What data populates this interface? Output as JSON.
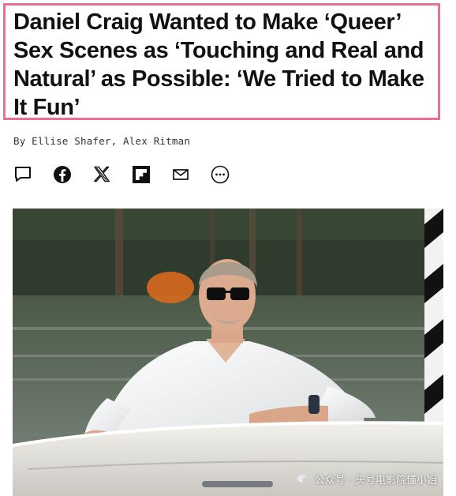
{
  "article": {
    "headline": "Daniel Craig Wanted to Make ‘Queer’ Sex Scenes as ‘Touching and Real and Natural’ as Possible: ‘We Tried to Make It Fun’",
    "byline": "By Ellise Shafer, Alex Ritman"
  },
  "share": {
    "icons": [
      "comment-icon",
      "facebook-icon",
      "x-icon",
      "flipboard-icon",
      "email-icon",
      "more-icon"
    ]
  },
  "photo": {
    "watermark": "公众号 · 头号电影院懂小姐"
  },
  "colors": {
    "highlight_border": "#e96e99",
    "text": "#111111"
  }
}
